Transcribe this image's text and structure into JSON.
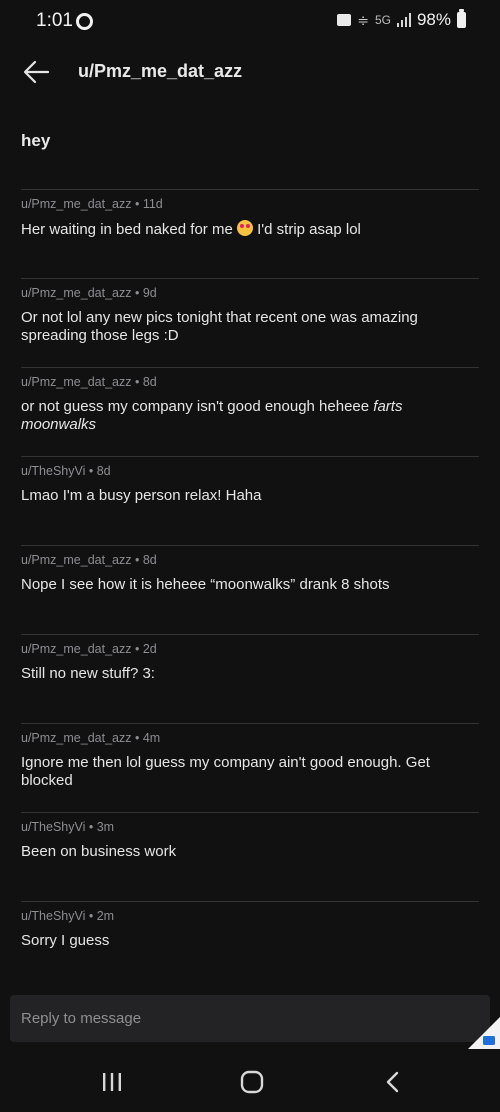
{
  "status_bar": {
    "time": "1:01",
    "network": "5G",
    "battery": "98%",
    "battery_level": 0.98
  },
  "header": {
    "title": "u/Pmz_me_dat_azz",
    "back_icon": "back-arrow-icon"
  },
  "subject": "hey",
  "messages": [
    {
      "author": "u/Pmz_me_dat_azz",
      "age": "11d",
      "text_before": "Her waiting in bed naked for me",
      "emoji": "heart-eyes-emoji-icon",
      "text_after": "I'd strip asap lol"
    },
    {
      "author": "u/Pmz_me_dat_azz",
      "age": "9d",
      "text": "Or not lol any new pics tonight that recent one was amazing spreading those legs :D"
    },
    {
      "author": "u/Pmz_me_dat_azz",
      "age": "8d",
      "text": "or not guess my company isn't good enough heheee",
      "text_italic": "farts moonwalks"
    },
    {
      "author": "u/TheShyVi",
      "age": "8d",
      "text": "Lmao I'm a busy person relax! Haha"
    },
    {
      "author": "u/Pmz_me_dat_azz",
      "age": "8d",
      "text": "Nope I see how it is heheee “moonwalks” drank 8 shots"
    },
    {
      "author": "u/Pmz_me_dat_azz",
      "age": "2d",
      "text": "Still no new stuff? 3:"
    },
    {
      "author": "u/Pmz_me_dat_azz",
      "age": "4m",
      "text": "Ignore me then lol guess my company ain't good enough. Get blocked"
    },
    {
      "author": "u/TheShyVi",
      "age": "3m",
      "text": "Been on business work"
    },
    {
      "author": "u/TheShyVi",
      "age": "2m",
      "text": "Sorry I guess"
    }
  ],
  "reply": {
    "placeholder": "Reply to message"
  },
  "colors": {
    "background": "#111112",
    "divider": "#333336",
    "meta_text": "#8d8d92",
    "reply_box": "#232325",
    "corner_badge": "#1e6fd9"
  },
  "nav": {
    "recents_icon": "recents-icon",
    "home_icon": "home-icon",
    "back_icon": "nav-back-icon"
  }
}
